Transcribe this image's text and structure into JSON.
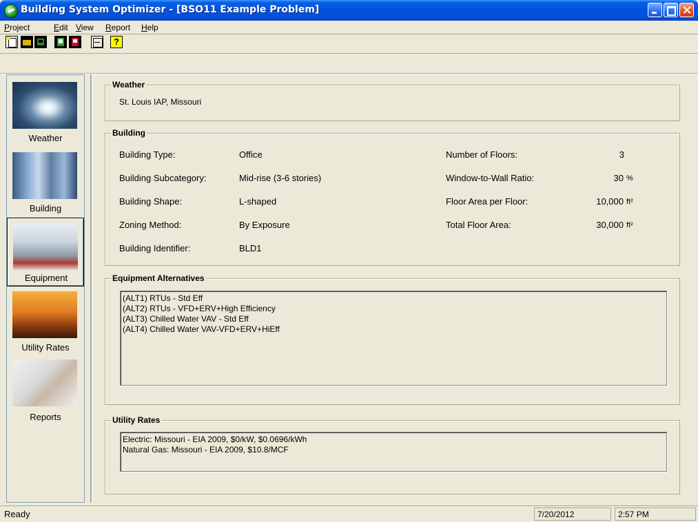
{
  "window": {
    "title": "Building System Optimizer - [BSO11 Example Problem]"
  },
  "menu": [
    {
      "label_u": "P",
      "label_rest": "roject"
    },
    {
      "label_u": "E",
      "label_rest": "dit"
    },
    {
      "label_u": "V",
      "label_rest": "iew"
    },
    {
      "label_u": "R",
      "label_rest": "eport"
    },
    {
      "label_u": "H",
      "label_rest": "elp"
    }
  ],
  "toolbar": {
    "icons": [
      "new-project-icon",
      "open-project-icon",
      "save-project-icon",
      "export-icon",
      "save-report-icon",
      "calculator-icon",
      "help-icon"
    ]
  },
  "sidebar": {
    "items": [
      {
        "label": "Weather",
        "icon": "hurricane-icon"
      },
      {
        "label": "Building",
        "icon": "office-building-icon"
      },
      {
        "label": "Equipment",
        "icon": "rooftop-unit-icon"
      },
      {
        "label": "Utility Rates",
        "icon": "power-lines-icon"
      },
      {
        "label": "Reports",
        "icon": "report-document-icon"
      }
    ],
    "active": "Equipment"
  },
  "weather": {
    "title": "Weather",
    "location": "St. Louis IAP, Missouri"
  },
  "building": {
    "title": "Building",
    "left": [
      {
        "label": "Building Type:",
        "value": "Office"
      },
      {
        "label": "Building Subcategory:",
        "value": "Mid-rise (3-6 stories)"
      },
      {
        "label": "Building Shape:",
        "value": "L-shaped"
      },
      {
        "label": "Zoning Method:",
        "value": "By Exposure"
      },
      {
        "label": "Building Identifier:",
        "value": "BLD1"
      }
    ],
    "right": [
      {
        "label": "Number of Floors:",
        "value": "3",
        "unit": ""
      },
      {
        "label": "Window-to-Wall Ratio:",
        "value": "30",
        "unit": "%"
      },
      {
        "label": "Floor Area per Floor:",
        "value": "10,000",
        "unit": "ft²"
      },
      {
        "label": "Total Floor Area:",
        "value": "30,000",
        "unit": "ft²"
      }
    ]
  },
  "equipment": {
    "title": "Equipment Alternatives",
    "items": [
      "(ALT1) RTUs - Std Eff",
      "(ALT2) RTUs - VFD+ERV+High Efficiency",
      "(ALT3) Chilled Water VAV - Std Eff",
      "(ALT4) Chilled Water VAV-VFD+ERV+HiEff"
    ]
  },
  "utility": {
    "title": "Utility Rates",
    "items": [
      "Electric:  Missouri - EIA 2009,  $0/kW,  $0.0696/kWh",
      "Natural Gas:  Missouri - EIA 2009,  $10.8/MCF"
    ]
  },
  "status": {
    "text": "Ready",
    "date": "7/20/2012",
    "time": "2:57 PM"
  },
  "colors": {
    "titlebar": "#0053e0",
    "face": "#ece9d8"
  }
}
